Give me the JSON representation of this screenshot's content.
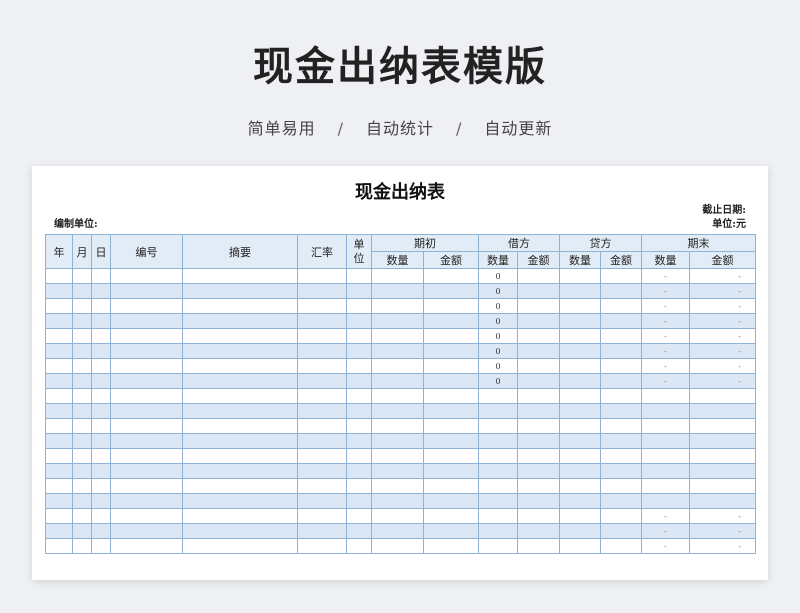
{
  "hero": {
    "title": "现金出纳表模版",
    "tags": [
      "简单易用",
      "自动统计",
      "自动更新"
    ],
    "separator": "/"
  },
  "sheet": {
    "title": "现金出纳表",
    "deadline_label": "截止日期:",
    "compiler_label": "编制单位:",
    "unit_label": "单位:元"
  },
  "table": {
    "headers": {
      "year": "年",
      "month": "月",
      "day": "日",
      "number": "编号",
      "summary": "摘要",
      "rate": "汇率",
      "unit": "单位",
      "opening": "期初",
      "debit": "借方",
      "credit": "贷方",
      "closing": "期末",
      "qty": "数量",
      "amount": "金额"
    },
    "rows": [
      {
        "debit_qty": "0",
        "closing_qty": "-",
        "closing_amount": "-"
      },
      {
        "debit_qty": "0",
        "closing_qty": "-",
        "closing_amount": "-"
      },
      {
        "debit_qty": "0",
        "closing_qty": "-",
        "closing_amount": "-"
      },
      {
        "debit_qty": "0",
        "closing_qty": "-",
        "closing_amount": "-"
      },
      {
        "debit_qty": "0",
        "closing_qty": "-",
        "closing_amount": "-"
      },
      {
        "debit_qty": "0",
        "closing_qty": "-",
        "closing_amount": "-"
      },
      {
        "debit_qty": "0",
        "closing_qty": "-",
        "closing_amount": "-"
      },
      {
        "debit_qty": "0",
        "closing_qty": "-",
        "closing_amount": "-"
      },
      {
        "debit_qty": "",
        "closing_qty": "",
        "closing_amount": ""
      },
      {
        "debit_qty": "",
        "closing_qty": "",
        "closing_amount": ""
      },
      {
        "debit_qty": "",
        "closing_qty": "",
        "closing_amount": ""
      },
      {
        "debit_qty": "",
        "closing_qty": "",
        "closing_amount": ""
      },
      {
        "debit_qty": "",
        "closing_qty": "",
        "closing_amount": ""
      },
      {
        "debit_qty": "",
        "closing_qty": "",
        "closing_amount": ""
      },
      {
        "debit_qty": "",
        "closing_qty": "",
        "closing_amount": ""
      },
      {
        "debit_qty": "",
        "closing_qty": "",
        "closing_amount": ""
      },
      {
        "debit_qty": "",
        "closing_qty": "-",
        "closing_amount": "-"
      },
      {
        "debit_qty": "",
        "closing_qty": "-",
        "closing_amount": "-"
      },
      {
        "debit_qty": "",
        "closing_qty": "-",
        "closing_amount": "-"
      }
    ]
  },
  "colors": {
    "header_bg": "#e2ecf7",
    "alt_row": "#dbe7f4",
    "border": "#8fb3d6"
  }
}
